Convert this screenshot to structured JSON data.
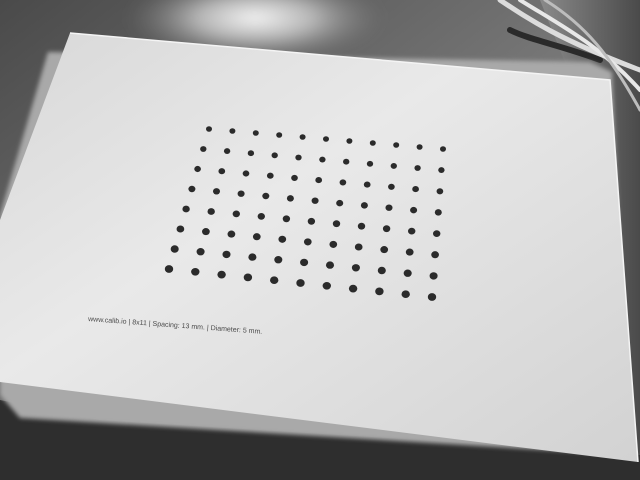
{
  "photo": {
    "palette": {
      "background": "#3a3a3a",
      "paper_light": "#e6e6e6",
      "paper_shadow": "#b9b9b9",
      "dots": "#2b2b2b"
    }
  },
  "calibration_target": {
    "pattern": "dot grid",
    "rows": 8,
    "columns": 11,
    "caption": "www.calib.io | 8x11 | Spacing: 13 mm. | Diameter: 5 mm."
  }
}
